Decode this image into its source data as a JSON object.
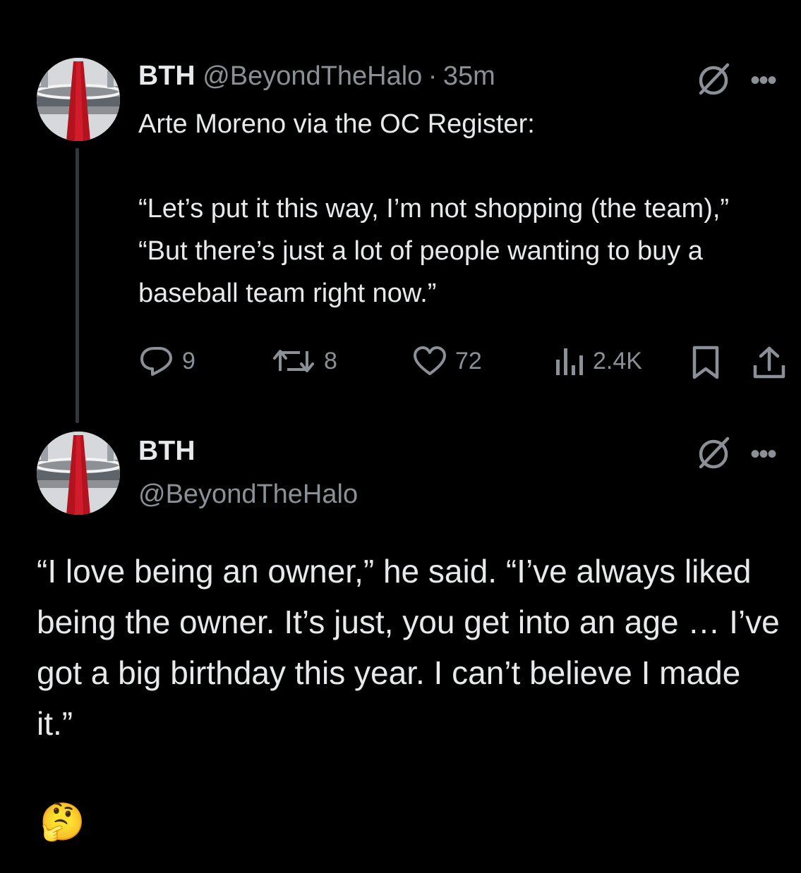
{
  "post1": {
    "display_name": "BTH",
    "handle": "@BeyondTheHalo",
    "separator": "·",
    "time": "35m",
    "body": "Arte Moreno via the OC Register:\n\n“Let’s put it this way, I’m not shopping (the team),” “But there’s just a lot of people wanting to buy a baseball team right now.”",
    "metrics": {
      "replies": "9",
      "reposts": "8",
      "likes": "72",
      "views": "2.4K"
    },
    "icons": {
      "grok": "slashed-circle-icon",
      "more": "more-horizontal-icon",
      "reply": "reply-bubble-icon",
      "repost": "repost-arrows-icon",
      "like": "heart-icon",
      "views": "bar-chart-icon",
      "bookmark": "bookmark-icon",
      "share": "share-upload-icon"
    }
  },
  "post2": {
    "display_name": "BTH",
    "handle": "@BeyondTheHalo",
    "body": "“I love being an owner,” he said. “I’ve always liked being the owner. It’s just, you get into an age … I’ve got a big birthday this year. I can’t believe I made it.”",
    "emoji": "🤔"
  },
  "more_glyph": "•••",
  "colors": {
    "background": "#000000",
    "text": "#e7e9ea",
    "muted": "#8b9096",
    "thread_line": "#33363a",
    "halo_red": "#b3121f"
  }
}
